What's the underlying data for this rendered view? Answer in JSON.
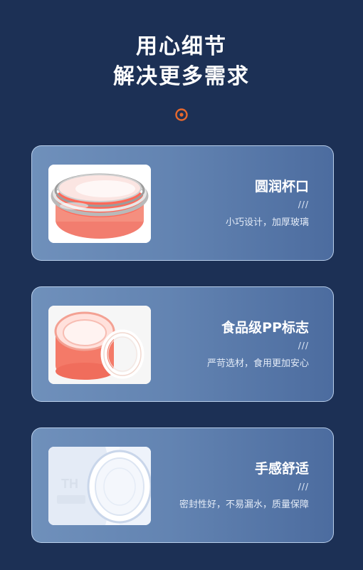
{
  "header": {
    "title_line1": "用心细节",
    "title_line2": "解决更多需求",
    "marker_icon": "target-icon",
    "accent_color": "#e8692d"
  },
  "features": [
    {
      "title": "圆润杯口",
      "slashes": "///",
      "description": "小巧设计，加厚玻璃",
      "image": "glass-rim-photo"
    },
    {
      "title": "食品级PP标志",
      "slashes": "///",
      "description": "严苛选材，食用更加安心",
      "image": "lid-seal-ring-photo"
    },
    {
      "title": "手感舒适",
      "slashes": "///",
      "description": "密封性好，不易漏水，质量保障",
      "image": "bottle-lid-photo"
    }
  ],
  "colors": {
    "background": "#1c3055",
    "card": "#6384b2",
    "card_border": "#c8dcf5"
  }
}
